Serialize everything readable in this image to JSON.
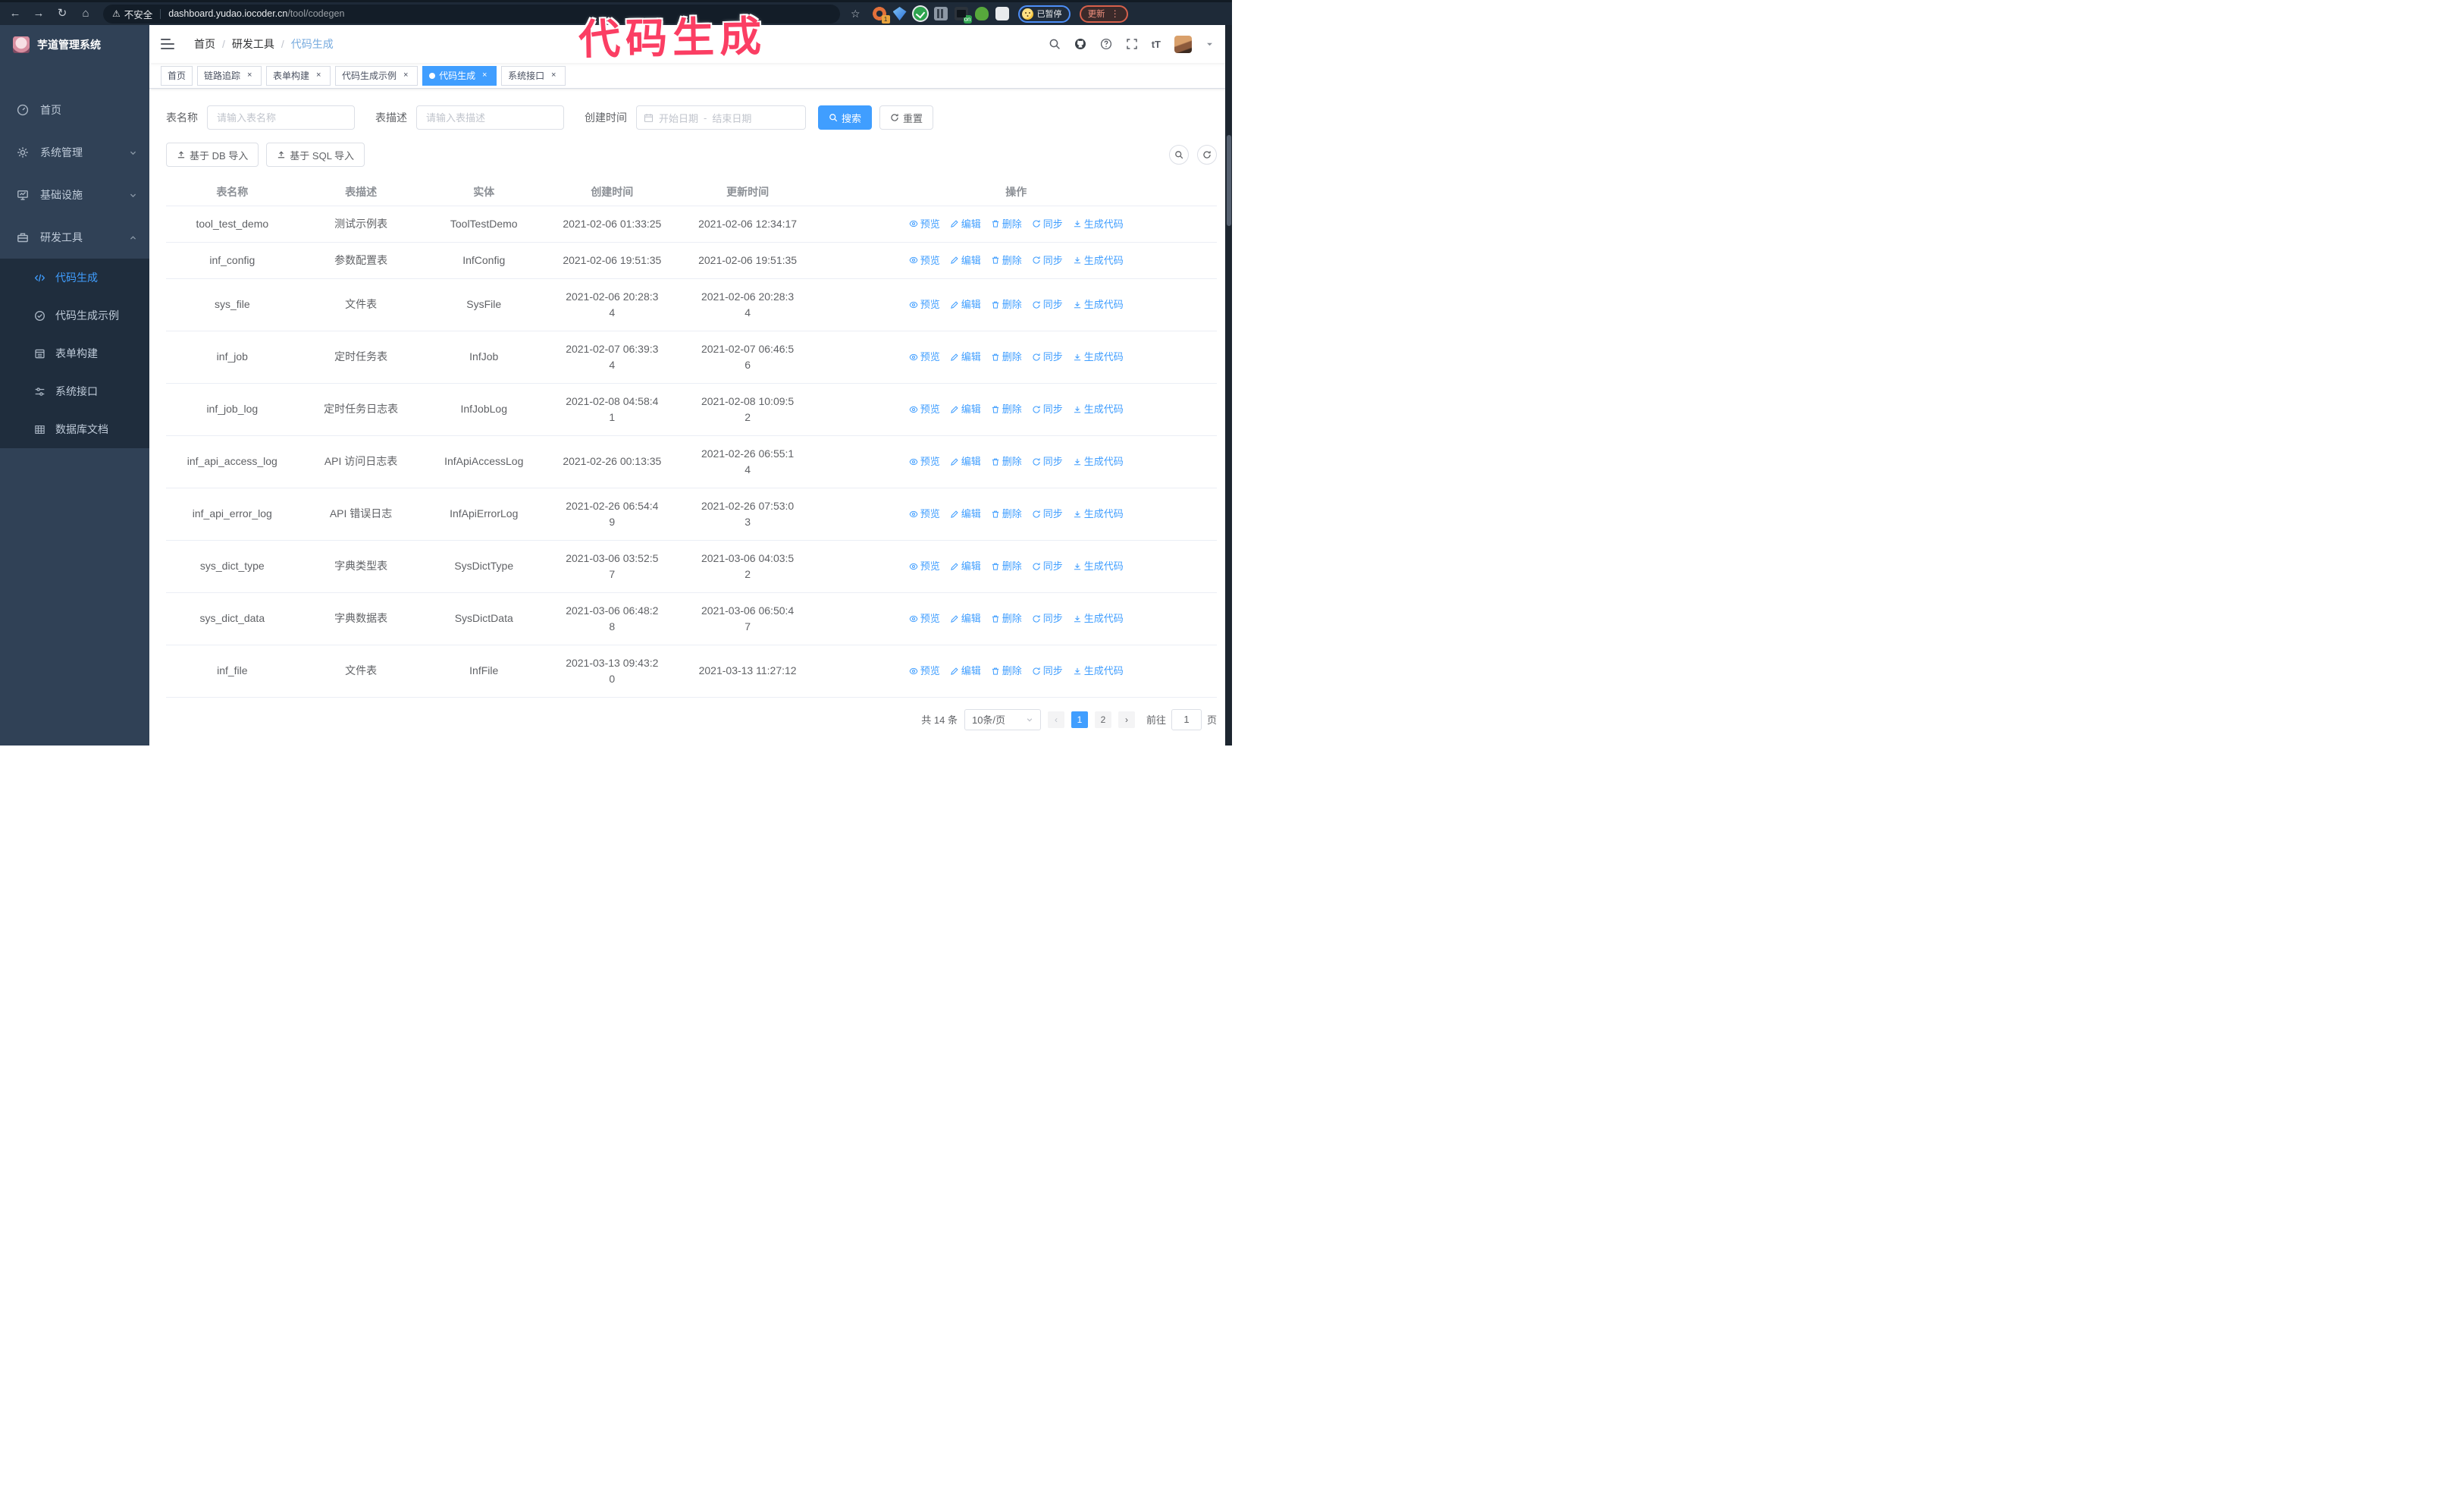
{
  "annotation": {
    "text": "代码生成"
  },
  "icons": {
    "back": "←",
    "forward": "→",
    "reload": "↻",
    "home": "⌂",
    "star": "☆",
    "warning": "⚠",
    "menu_dots": "⋮",
    "close": "×",
    "breadcrumb_sep": "/",
    "font_size": "tT"
  },
  "browser": {
    "insecure_label": "不安全",
    "url_host": "dashboard.yudao.iocoder.cn",
    "url_path": "/tool/codegen",
    "extension_badge_1": "1",
    "extension_badge_on": "on",
    "profile_badge": "已暂停",
    "update_button": "更新"
  },
  "sidebar": {
    "logo_title": "芋道管理系统",
    "items": [
      {
        "label": "首页"
      },
      {
        "label": "系统管理"
      },
      {
        "label": "基础设施"
      },
      {
        "label": "研发工具"
      }
    ],
    "submenu": [
      {
        "label": "代码生成",
        "active": true
      },
      {
        "label": "代码生成示例"
      },
      {
        "label": "表单构建"
      },
      {
        "label": "系统接口"
      },
      {
        "label": "数据库文档"
      }
    ]
  },
  "header": {
    "breadcrumb": [
      "首页",
      "研发工具",
      "代码生成"
    ]
  },
  "tabs": [
    {
      "label": "首页",
      "closable": false,
      "active": false
    },
    {
      "label": "链路追踪",
      "closable": true,
      "active": false
    },
    {
      "label": "表单构建",
      "closable": true,
      "active": false
    },
    {
      "label": "代码生成示例",
      "closable": true,
      "active": false
    },
    {
      "label": "代码生成",
      "closable": true,
      "active": true
    },
    {
      "label": "系统接口",
      "closable": true,
      "active": false
    }
  ],
  "filters": {
    "table_name_label": "表名称",
    "table_name_placeholder": "请输入表名称",
    "table_desc_label": "表描述",
    "table_desc_placeholder": "请输入表描述",
    "create_time_label": "创建时间",
    "date_start_placeholder": "开始日期",
    "date_separator": "-",
    "date_end_placeholder": "结束日期",
    "search_label": "搜索",
    "reset_label": "重置"
  },
  "toolbar": {
    "import_db_label": "基于 DB 导入",
    "import_sql_label": "基于 SQL 导入"
  },
  "table": {
    "columns": [
      "表名称",
      "表描述",
      "实体",
      "创建时间",
      "更新时间",
      "操作"
    ],
    "actions": [
      "预览",
      "编辑",
      "删除",
      "同步",
      "生成代码"
    ],
    "rows": [
      {
        "name": "tool_test_demo",
        "desc": "测试示例表",
        "entity": "ToolTestDemo",
        "created": "2021-02-06 01:33:25",
        "updated": "2021-02-06 12:34:17"
      },
      {
        "name": "inf_config",
        "desc": "参数配置表",
        "entity": "InfConfig",
        "created": "2021-02-06 19:51:35",
        "updated": "2021-02-06 19:51:35"
      },
      {
        "name": "sys_file",
        "desc": "文件表",
        "entity": "SysFile",
        "created": "2021-02-06 20:28:3\n4",
        "updated": "2021-02-06 20:28:3\n4"
      },
      {
        "name": "inf_job",
        "desc": "定时任务表",
        "entity": "InfJob",
        "created": "2021-02-07 06:39:3\n4",
        "updated": "2021-02-07 06:46:5\n6"
      },
      {
        "name": "inf_job_log",
        "desc": "定时任务日志表",
        "entity": "InfJobLog",
        "created": "2021-02-08 04:58:4\n1",
        "updated": "2021-02-08 10:09:5\n2"
      },
      {
        "name": "inf_api_access_log",
        "desc": "API 访问日志表",
        "entity": "InfApiAccessLog",
        "created": "2021-02-26 00:13:35",
        "updated": "2021-02-26 06:55:1\n4"
      },
      {
        "name": "inf_api_error_log",
        "desc": "API 错误日志",
        "entity": "InfApiErrorLog",
        "created": "2021-02-26 06:54:4\n9",
        "updated": "2021-02-26 07:53:0\n3"
      },
      {
        "name": "sys_dict_type",
        "desc": "字典类型表",
        "entity": "SysDictType",
        "created": "2021-03-06 03:52:5\n7",
        "updated": "2021-03-06 04:03:5\n2"
      },
      {
        "name": "sys_dict_data",
        "desc": "字典数据表",
        "entity": "SysDictData",
        "created": "2021-03-06 06:48:2\n8",
        "updated": "2021-03-06 06:50:4\n7"
      },
      {
        "name": "inf_file",
        "desc": "文件表",
        "entity": "InfFile",
        "created": "2021-03-13 09:43:2\n0",
        "updated": "2021-03-13 11:27:12"
      }
    ]
  },
  "pagination": {
    "total_label": "共 14 条",
    "page_size_label": "10条/页",
    "prev_label": "‹",
    "next_label": "›",
    "pages": [
      "1",
      "2"
    ],
    "active_page": "1",
    "goto_label": "前往",
    "goto_value": "1",
    "goto_suffix": "页"
  }
}
